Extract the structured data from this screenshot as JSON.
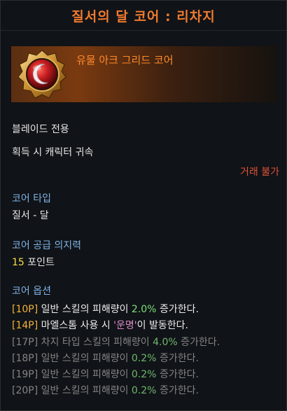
{
  "title": "질서의 달 코어 : 리차지",
  "item": {
    "grade_label": "유물 아크 그리드 코어",
    "icon": "moon-core-gem-icon"
  },
  "info": {
    "class_only": "블레이드 전용",
    "bind": "획득 시 캐릭터 귀속",
    "trade": "거래 불가"
  },
  "core_type": {
    "label": "코어 타입",
    "value": "질서 - 달"
  },
  "core_supply": {
    "label": "코어 공급 의지력",
    "number": "15",
    "unit": " 포인트"
  },
  "core_options": {
    "label": "코어 옵션",
    "items": [
      {
        "level": "[10P]",
        "pre": " 일반 스킬의 피해량이 ",
        "value": "2.0%",
        "post": " 증가한다.",
        "active": true
      },
      {
        "level": "[14P]",
        "pre": " 마엘스톰 사용 시 ",
        "keyword": "'운명'",
        "post": "이 발동한다.",
        "active": true
      },
      {
        "level": "[17P]",
        "pre": " 차지 타입 스킬의 피해량이 ",
        "value": "4.0%",
        "post": " 증가한다.",
        "active": false
      },
      {
        "level": "[18P]",
        "pre": " 일반 스킬의 피해량이 ",
        "value": "0.2%",
        "post": " 증가한다.",
        "active": false
      },
      {
        "level": "[19P]",
        "pre": " 일반 스킬의 피해량이 ",
        "value": "0.2%",
        "post": " 증가한다.",
        "active": false
      },
      {
        "level": "[20P]",
        "pre": " 일반 스킬의 피해량이 ",
        "value": "0.2%",
        "post": " 증가한다.",
        "active": false
      }
    ]
  },
  "colors": {
    "title": "#f07a2f",
    "grade": "#ff8a2a",
    "section": "#7fb3e6",
    "trade": "#e0513a",
    "level_active": "#f3b238",
    "value_active": "#7ee07a",
    "inactive": "#838383"
  }
}
